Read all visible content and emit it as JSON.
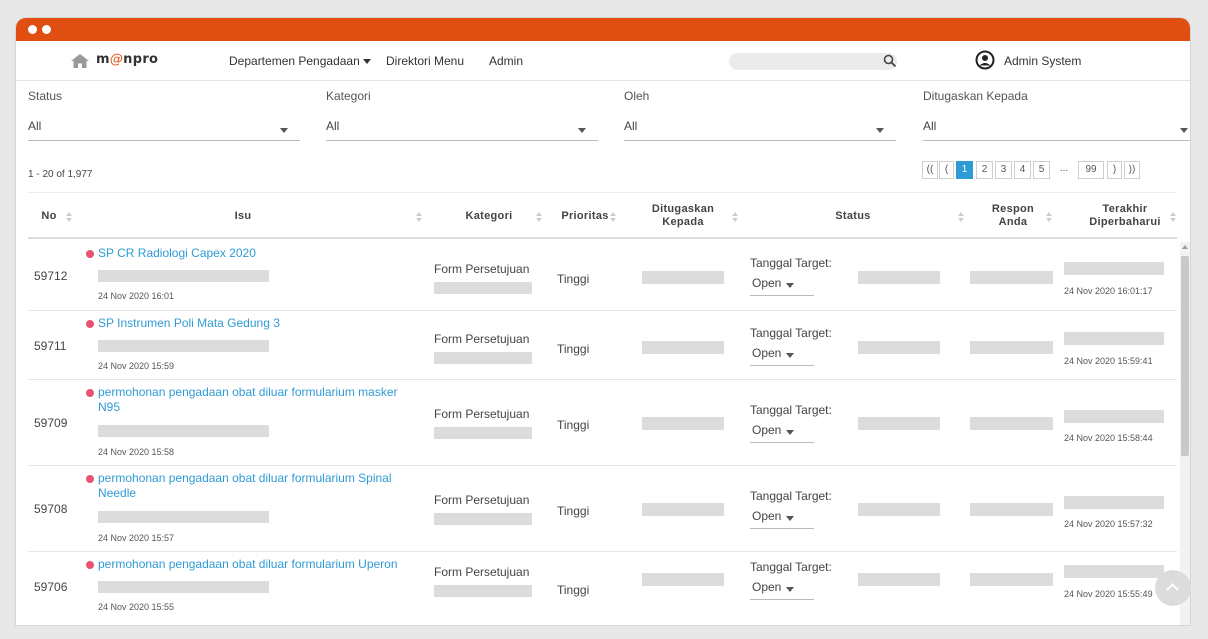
{
  "navbar": {
    "logo_text": "m@npro",
    "logo_prefix": "m",
    "logo_at": "@",
    "logo_suffix": "npro",
    "department_label": "Departemen Pengadaan",
    "directory_label": "Direktori Menu",
    "admin_label": "Admin",
    "search_placeholder": "",
    "search_value": "",
    "user_name": "Admin System"
  },
  "filters": [
    {
      "label": "Status",
      "value": "All"
    },
    {
      "label": "Kategori",
      "value": "All"
    },
    {
      "label": "Oleh",
      "value": "All"
    },
    {
      "label": "Ditugaskan Kepada",
      "value": "All"
    }
  ],
  "result_count": "1 - 20 of 1,977",
  "pagination": {
    "first": "((",
    "prev": "(",
    "pages": [
      "1",
      "2",
      "3",
      "4",
      "5"
    ],
    "ellipsis": "...",
    "last_page": "99",
    "next": ")",
    "last": "))",
    "current": "1"
  },
  "table": {
    "headers": {
      "no": "No",
      "isu": "Isu",
      "kategori": "Kategori",
      "prioritas": "Prioritas",
      "ditugaskan_1": "Ditugaskan",
      "ditugaskan_2": "Kepada",
      "status": "Status",
      "respon_1": "Respon",
      "respon_2": "Anda",
      "terakhir_1": "Terakhir",
      "terakhir_2": "Diperbaharui"
    },
    "rows": [
      {
        "no": "59712",
        "title": "SP CR Radiologi Capex 2020",
        "title_line2": "",
        "date": "24 Nov 2020 16:01",
        "kategori": "Form Persetujuan",
        "prioritas": "Tinggi",
        "target_label": "Tanggal Target:",
        "status": "Open",
        "updated": "24 Nov 2020 16:01:17"
      },
      {
        "no": "59711",
        "title": "SP Instrumen Poli Mata Gedung 3",
        "title_line2": "",
        "date": "24 Nov 2020 15:59",
        "kategori": "Form Persetujuan",
        "prioritas": "Tinggi",
        "target_label": "Tanggal Target:",
        "status": "Open",
        "updated": "24 Nov 2020 15:59:41"
      },
      {
        "no": "59709",
        "title": "permohonan pengadaan obat diluar formularium masker",
        "title_line2": "N95",
        "date": "24 Nov 2020 15:58",
        "kategori": "Form Persetujuan",
        "prioritas": "Tinggi",
        "target_label": "Tanggal Target:",
        "status": "Open",
        "updated": "24 Nov 2020 15:58:44"
      },
      {
        "no": "59708",
        "title": "permohonan pengadaan obat diluar formularium Spinal",
        "title_line2": "Needle",
        "date": "24 Nov 2020 15:57",
        "kategori": "Form Persetujuan",
        "prioritas": "Tinggi",
        "target_label": "Tanggal Target:",
        "status": "Open",
        "updated": "24 Nov 2020 15:57:32"
      },
      {
        "no": "59706",
        "title": "permohonan pengadaan obat diluar formularium Uperon",
        "title_line2": "",
        "date": "24 Nov 2020 15:55",
        "kategori": "Form Persetujuan",
        "prioritas": "Tinggi",
        "target_label": "Tanggal Target:",
        "status": "Open",
        "updated": "24 Nov 2020 15:55:49"
      }
    ]
  },
  "colors": {
    "brand": "#e04e12",
    "link": "#2f9bd6",
    "bullet": "#e8536f",
    "redacted": "#dcdcdc"
  },
  "icons": {
    "home": "home-icon",
    "search": "search-icon",
    "user": "user-circle-icon",
    "scroll_top": "chevron-up-icon"
  }
}
